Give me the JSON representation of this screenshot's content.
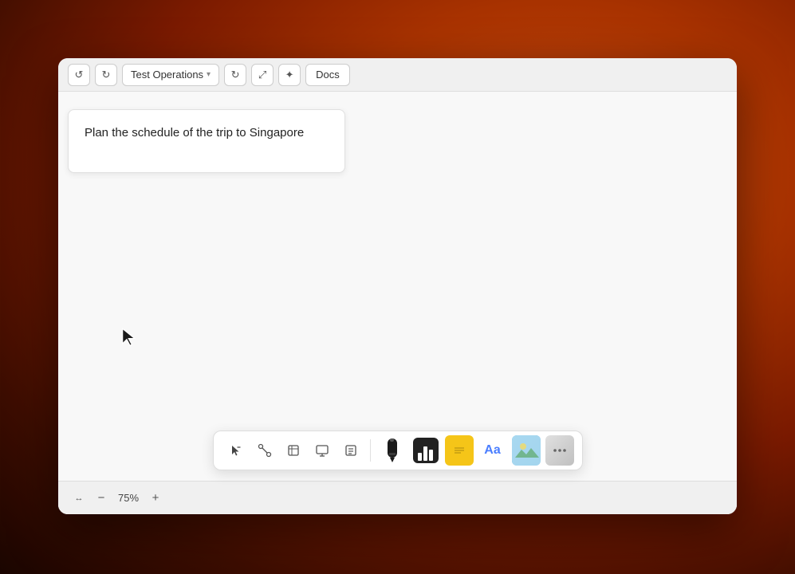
{
  "background": {
    "gradient": "radial orange macOS wallpaper"
  },
  "window": {
    "title": "Test Operations"
  },
  "toolbar": {
    "undo_icon": "↺",
    "redo_icon": "↻",
    "title_label": "Test Operations",
    "chevron": "▾",
    "refresh_icon": "↻",
    "expand_icon": "⤢",
    "settings_icon": "✦",
    "docs_label": "Docs"
  },
  "canvas": {
    "sticky_text": "Plan the schedule of the trip to Singapore"
  },
  "status_bar": {
    "fit_icon": "↔",
    "zoom_minus": "−",
    "zoom_level": "75%",
    "zoom_plus": "+"
  },
  "bottom_toolbar": {
    "select_tool": "▷",
    "connect_tool": "⌒",
    "frame_tool": "⊞",
    "present_tool": "▣",
    "note_tool": "☰",
    "pen_tool": "✏",
    "chart_bars": [
      {
        "height": 10,
        "width": 5
      },
      {
        "height": 18,
        "width": 5
      },
      {
        "height": 14,
        "width": 5
      }
    ],
    "sticky_note_color": "#f5c518",
    "text_label": "Aa",
    "text_color": "#4a7eff"
  }
}
